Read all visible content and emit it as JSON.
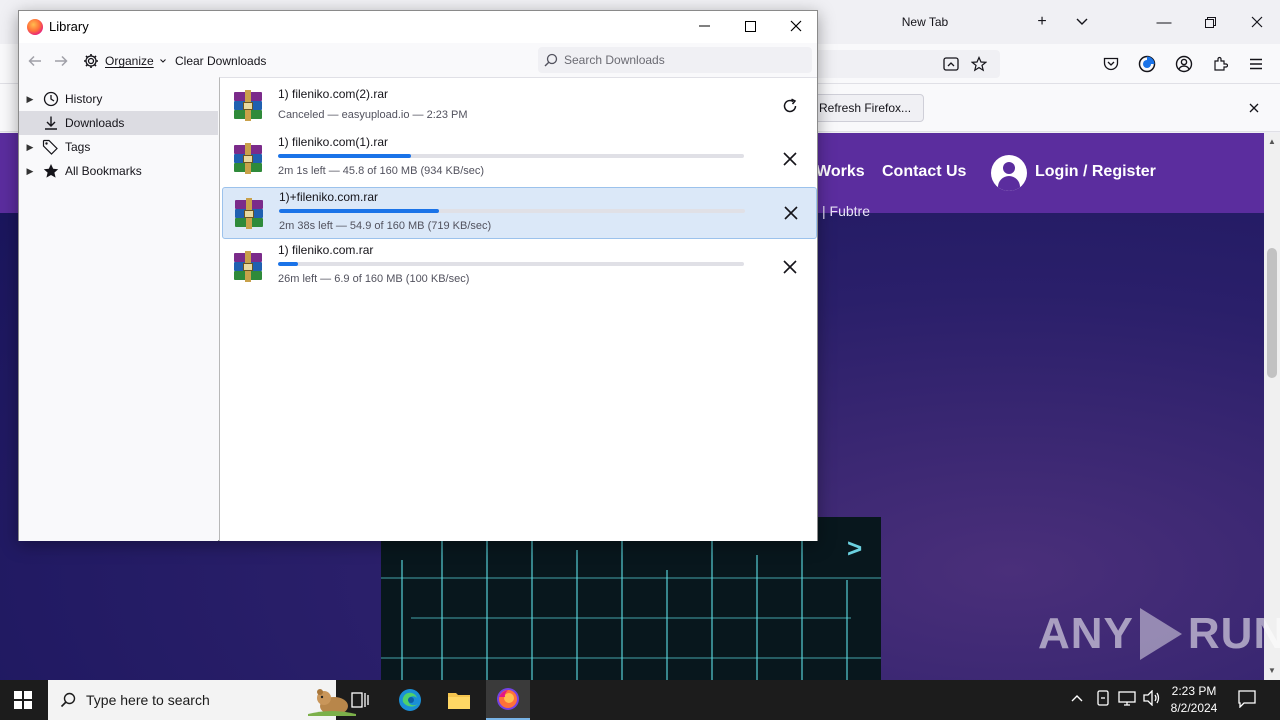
{
  "browser": {
    "tab_title": "New Tab",
    "notification": {
      "button_label": "Refresh Firefox..."
    }
  },
  "website": {
    "nav": {
      "works": "Works",
      "contact": "Contact Us",
      "login": "Login / Register"
    },
    "subtext": "| Fubtre"
  },
  "watermark": {
    "text_left": "ANY",
    "text_right": "RUN"
  },
  "library": {
    "title": "Library",
    "toolbar": {
      "organize_label": "Organize",
      "clear_label": "Clear Downloads",
      "search_placeholder": "Search Downloads"
    },
    "sidebar": [
      {
        "label": "History",
        "icon": "clock-icon",
        "expandable": true,
        "selected": false
      },
      {
        "label": "Downloads",
        "icon": "download-icon",
        "expandable": false,
        "selected": true
      },
      {
        "label": "Tags",
        "icon": "tag-icon",
        "expandable": true,
        "selected": false
      },
      {
        "label": "All Bookmarks",
        "icon": "star-icon",
        "expandable": true,
        "selected": false
      }
    ],
    "downloads": [
      {
        "name": "1) fileniko.com(2).rar",
        "status": "Canceled — easyupload.io — 2:23 PM",
        "progress": null,
        "action": "retry",
        "selected": false
      },
      {
        "name": "1) fileniko.com(1).rar",
        "status": "2m 1s left — 45.8 of 160 MB (934 KB/sec)",
        "progress": 0.286,
        "action": "cancel",
        "selected": false
      },
      {
        "name": "1)+fileniko.com.rar",
        "status": "2m 38s left — 54.9 of 160 MB (719 KB/sec)",
        "progress": 0.343,
        "action": "cancel",
        "selected": true
      },
      {
        "name": "1) fileniko.com.rar",
        "status": "26m left — 6.9 of 160 MB (100 KB/sec)",
        "progress": 0.043,
        "action": "cancel",
        "selected": false
      }
    ],
    "progress_color": "#1a73e8"
  },
  "taskbar": {
    "search_placeholder": "Type here to search",
    "clock_time": "2:23 PM",
    "clock_date": "8/2/2024"
  }
}
